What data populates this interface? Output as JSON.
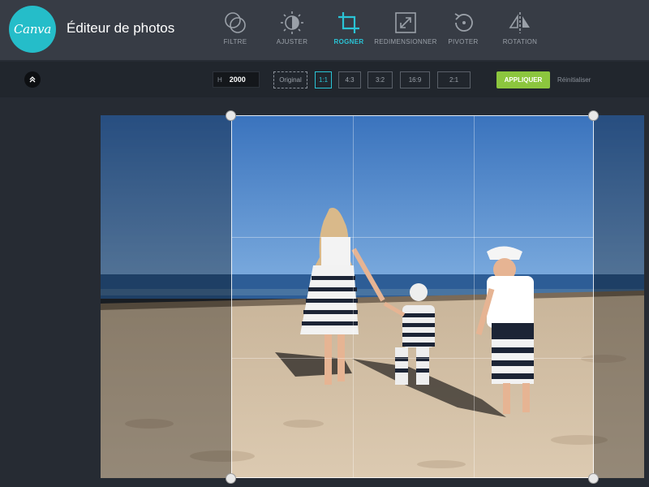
{
  "header": {
    "logo_text": "Canva",
    "title": "Éditeur de photos",
    "tools": [
      {
        "label": "FILTRE",
        "icon": "filter-icon"
      },
      {
        "label": "AJUSTER",
        "icon": "adjust-icon"
      },
      {
        "label": "ROGNER",
        "icon": "crop-icon",
        "active": true
      },
      {
        "label": "REDIMENSIONNER",
        "icon": "resize-icon"
      },
      {
        "label": "PIVOTER",
        "icon": "rotate-icon"
      },
      {
        "label": "ROTATION",
        "icon": "flip-icon"
      }
    ]
  },
  "toolbar": {
    "collapse_icon": "chevron-up-icon",
    "height_label": "H",
    "height_value": "2000",
    "ratios": [
      "Original",
      "1:1",
      "4:3",
      "3:2",
      "16:9",
      "2:1"
    ],
    "active_ratio": "1:1",
    "apply_label": "APPLIQUER",
    "reset_label": "Réinitialiser"
  },
  "colors": {
    "accent": "#2ac4d6",
    "apply": "#8cc63e",
    "header_bg": "#373c45",
    "logo_bg": "#25bdc9"
  }
}
